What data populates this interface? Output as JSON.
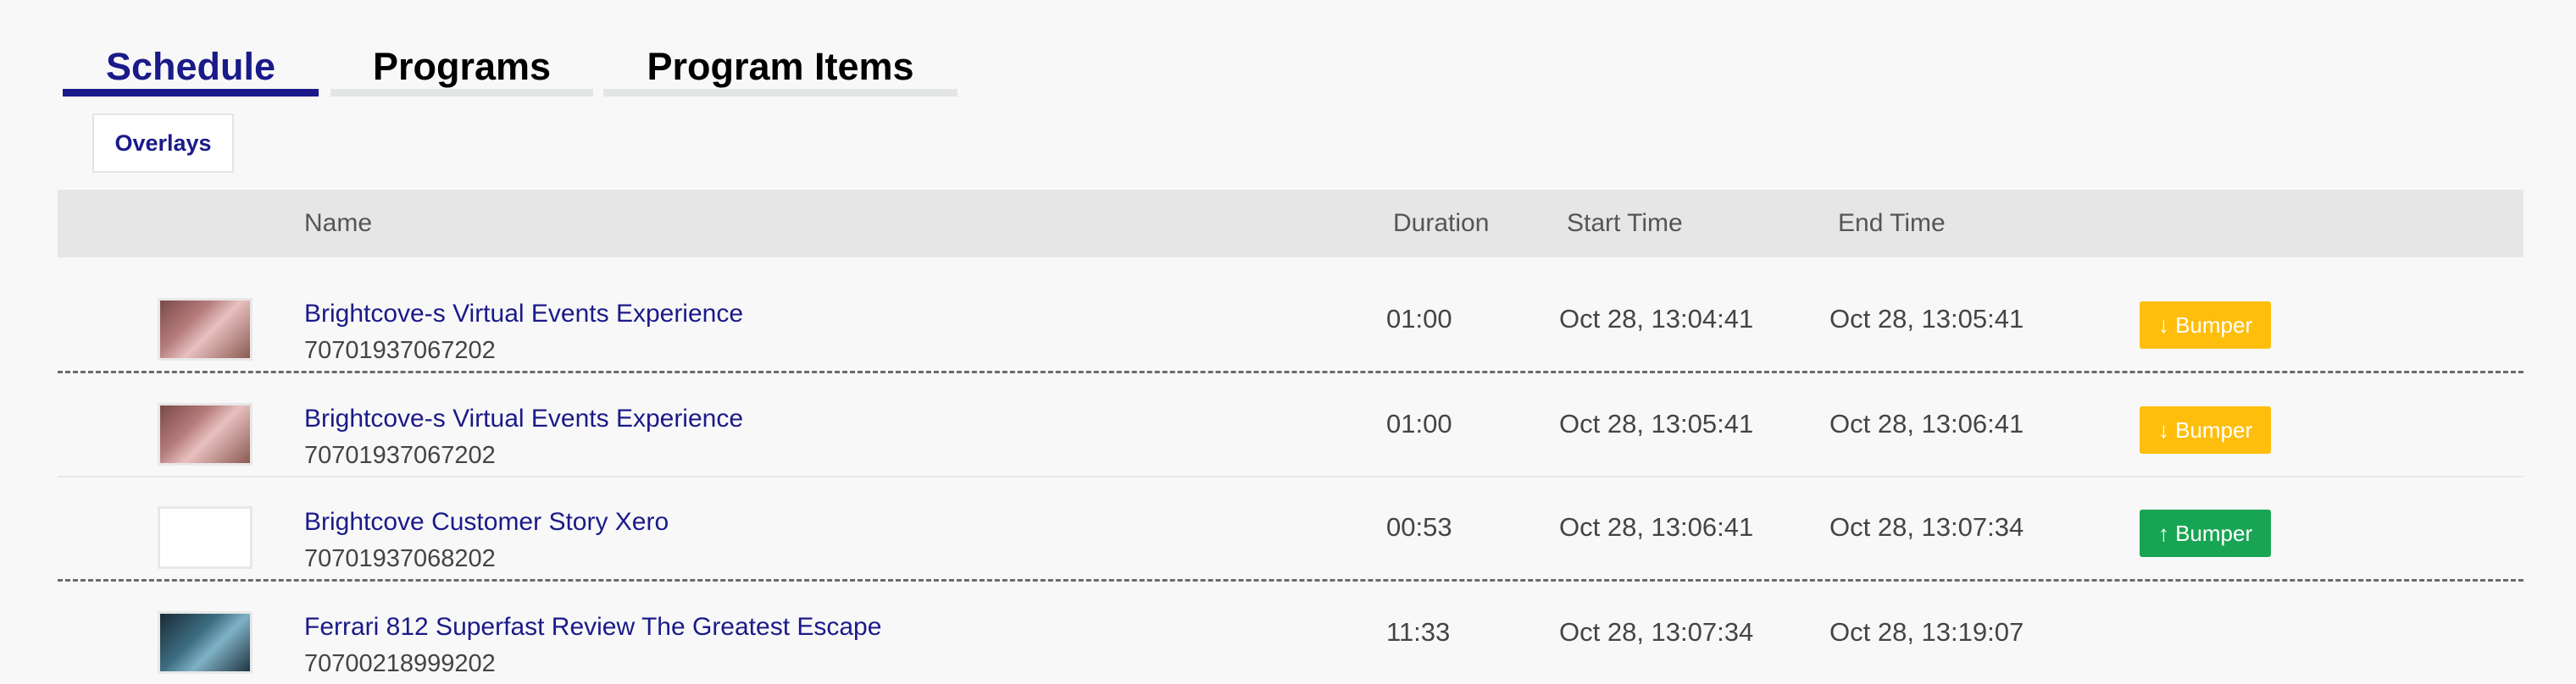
{
  "tabs": [
    {
      "label": "Schedule",
      "active": true
    },
    {
      "label": "Programs",
      "active": false
    },
    {
      "label": "Program Items",
      "active": false
    }
  ],
  "subtab": {
    "label": "Overlays"
  },
  "table": {
    "headers": {
      "name": "Name",
      "duration": "Duration",
      "start": "Start Time",
      "end": "End Time"
    },
    "rows": [
      {
        "name": "Brightcove-s Virtual Events Experience",
        "id": "70701937067202",
        "duration": "01:00",
        "start": "Oct 28, 13:04:41",
        "end": "Oct 28, 13:05:41",
        "badge": "↓ Bumper",
        "badge_color": "#ffbe0b",
        "thumb": "pink"
      },
      {
        "name": "Brightcove-s Virtual Events Experience",
        "id": "70701937067202",
        "duration": "01:00",
        "start": "Oct 28, 13:05:41",
        "end": "Oct 28, 13:06:41",
        "badge": "↓ Bumper",
        "badge_color": "#ffbe0b",
        "thumb": "pink"
      },
      {
        "name": "Brightcove Customer Story Xero",
        "id": "70701937068202",
        "duration": "00:53",
        "start": "Oct 28, 13:06:41",
        "end": "Oct 28, 13:07:34",
        "badge": "↑ Bumper",
        "badge_color": "#18a553",
        "thumb": "white"
      },
      {
        "name": "Ferrari 812 Superfast Review The Greatest Escape",
        "id": "70700218999202",
        "duration": "11:33",
        "start": "Oct 28, 13:07:34",
        "end": "Oct 28, 13:19:07",
        "badge": "",
        "thumb": "car"
      }
    ]
  },
  "colors": {
    "accent": "#1a1a8a",
    "bumper_down": "#ffbe0b",
    "bumper_up": "#18a553"
  }
}
